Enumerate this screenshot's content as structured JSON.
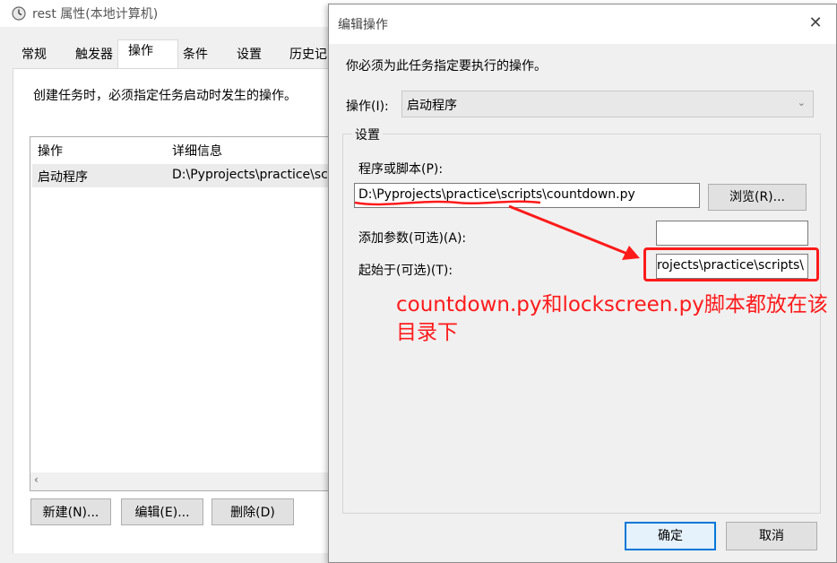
{
  "background_window": {
    "title": "rest 属性(本地计算机)",
    "tabs": [
      "常规",
      "触发器",
      "操作",
      "条件",
      "设置",
      "历史记"
    ],
    "active_tab": "操作",
    "description": "创建任务时，必须指定任务启动时发生的操作。",
    "list": {
      "columns": [
        "操作",
        "详细信息"
      ],
      "rows": [
        {
          "action": "启动程序",
          "details": "D:\\Pyprojects\\practice\\scr"
        }
      ]
    },
    "scroll_left_glyph": "‹",
    "buttons": {
      "new": "新建(N)...",
      "edit": "编辑(E)...",
      "delete": "删除(D)"
    }
  },
  "dialog": {
    "title": "编辑操作",
    "close_glyph": "✕",
    "instruction": "你必须为此任务指定要执行的操作。",
    "action_label": "操作(I):",
    "action_value": "启动程序",
    "settings_legend": "设置",
    "program_label": "程序或脚本(P):",
    "program_value": "D:\\Pyprojects\\practice\\scripts\\countdown.py",
    "browse_label": "浏览(R)...",
    "arguments_label": "添加参数(可选)(A):",
    "arguments_value": "",
    "start_in_label": "起始于(可选)(T):",
    "start_in_value": "D:\\Pyprojects\\practice\\scripts\\",
    "ok_label": "确定",
    "cancel_label": "取消"
  },
  "annotation": {
    "text": "countdown.py和lockscreen.py脚本都放在该目录下",
    "color": "#ff1a1a"
  },
  "colors": {
    "window_bg": "#f0f0f0",
    "button_bg": "#e1e1e1",
    "ok_border": "#0078d7",
    "selected_row": "#ebebeb"
  }
}
